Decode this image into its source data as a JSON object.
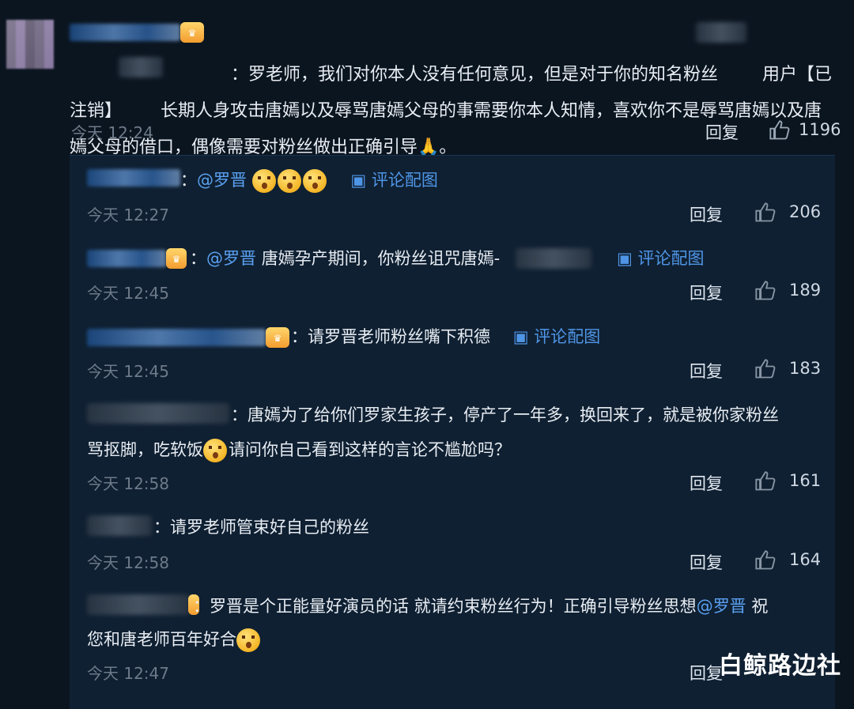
{
  "main_comment": {
    "text": "：罗老师，我们对你本人没有任何意见，但是对于你的知名粉丝        用户【已注销】       长期人身攻击唐嫣以及辱骂唐嫣父母的事需要你本人知情，喜欢你不是辱骂唐嫣以及唐嫣父母的借口，偶像需要对粉丝做出正确引导🙏。",
    "time": "今天 12:24",
    "reply_label": "回复",
    "likes": "1196"
  },
  "replies": [
    {
      "mention": "@罗晋",
      "text": "",
      "image_link": "评论配图",
      "time": "今天 12:27",
      "reply_label": "回复",
      "likes": "206"
    },
    {
      "mention": "@罗晋",
      "text": "唐嫣孕产期间，你粉丝诅咒唐嫣-",
      "image_link": "评论配图",
      "time": "今天 12:45",
      "reply_label": "回复",
      "likes": "189"
    },
    {
      "text": "：请罗晋老师粉丝嘴下积德",
      "image_link": "评论配图",
      "time": "今天 12:45",
      "reply_label": "回复",
      "likes": "183"
    },
    {
      "text_line1": "：唐嫣为了给你们罗家生孩子，停产了一年多，换回来了，就是被你家粉丝",
      "text_line2a": "骂抠脚，吃软饭",
      "text_line2b": "请问你自己看到这样的言论不尴尬吗？",
      "time": "今天 12:58",
      "reply_label": "回复",
      "likes": "161"
    },
    {
      "text": "：请罗老师管束好自己的粉丝",
      "time": "今天 12:58",
      "reply_label": "回复",
      "likes": "164"
    },
    {
      "text_line1a": "：罗晋是个正能量好演员的话  就请约束粉丝行为！正确引导粉丝思想",
      "mention": "@罗晋",
      "text_line1b": " 祝",
      "text_line2": "您和唐老师百年好合",
      "time": "今天 12:47",
      "reply_label": "回复"
    }
  ],
  "watermark": "白鲸路边社"
}
